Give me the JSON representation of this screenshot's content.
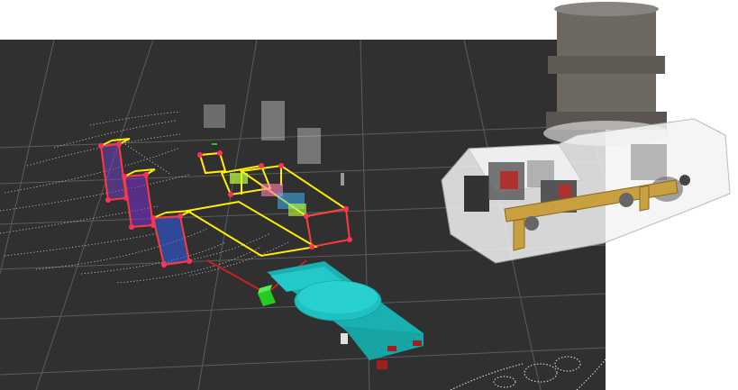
{
  "scene": {
    "background_color": "#303030",
    "grid_color": "#6a6a6a",
    "point_cloud_color": "#e8e8e8",
    "bbox_color": "#ffee00",
    "bbox_corner_color": "#ff3060",
    "robot_color": "#1ab0b0",
    "goal_marker_color": "#22cc22",
    "path_color": "#cc2020",
    "model_body_color": "#f2f2f2",
    "model_turret_color": "#7a746e",
    "model_beam_color": "#c8a040"
  }
}
